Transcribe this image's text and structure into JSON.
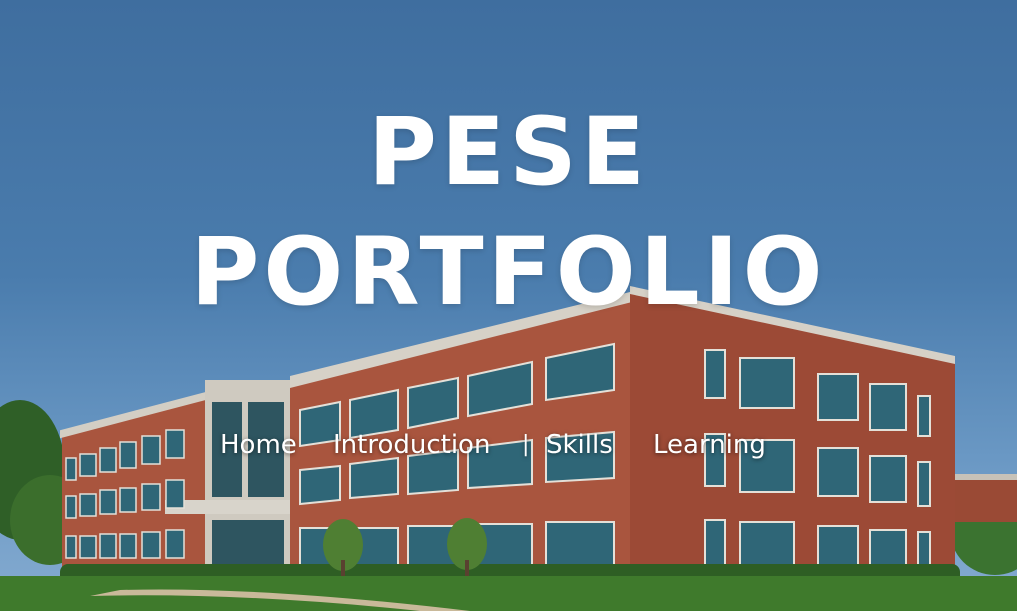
{
  "hero": {
    "title_line1": "PESE",
    "title_line2": "PORTFOLIO"
  },
  "nav": {
    "items": [
      {
        "label": "Home"
      },
      {
        "label": "Introduction"
      },
      {
        "label": "Skills"
      },
      {
        "label": "Learning"
      }
    ],
    "separator": "|"
  },
  "colors": {
    "sky": "#4a7cad",
    "brick": "#a5503a",
    "grass": "#3f7a2c",
    "text": "#ffffff"
  }
}
